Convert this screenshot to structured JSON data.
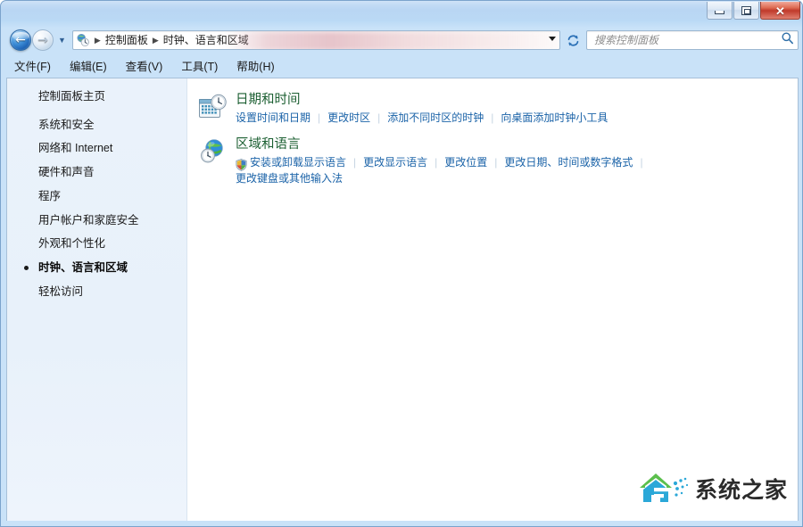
{
  "window": {
    "titlebar": {
      "minimize_label": "—",
      "maximize_label": "□",
      "close_label": "✕"
    },
    "accent_color": "#1b63a8",
    "heading_color": "#1d6033",
    "titlebar_color": "#b9d6f3"
  },
  "nav": {
    "back_arrow": "←",
    "forward_arrow": "→",
    "history_arrow": "▼",
    "breadcrumb": {
      "root_icon": "control-panel-icon",
      "separator": "▶",
      "items": [
        "控制面板",
        "时钟、语言和区域"
      ]
    },
    "refresh_icon": "refresh-icon",
    "dropdown_icon": "chevron-down-icon"
  },
  "search": {
    "placeholder": "搜索控制面板",
    "value": "",
    "icon": "search-icon"
  },
  "menubar": {
    "items": [
      {
        "label": "文件(F)"
      },
      {
        "label": "编辑(E)"
      },
      {
        "label": "查看(V)"
      },
      {
        "label": "工具(T)"
      },
      {
        "label": "帮助(H)"
      }
    ]
  },
  "sidebar": {
    "home_label": "控制面板主页",
    "items": [
      {
        "label": "系统和安全",
        "active": false
      },
      {
        "label": "网络和 Internet",
        "active": false
      },
      {
        "label": "硬件和声音",
        "active": false
      },
      {
        "label": "程序",
        "active": false
      },
      {
        "label": "用户帐户和家庭安全",
        "active": false
      },
      {
        "label": "外观和个性化",
        "active": false
      },
      {
        "label": "时钟、语言和区域",
        "active": true
      },
      {
        "label": "轻松访问",
        "active": false
      }
    ]
  },
  "content": {
    "categories": [
      {
        "icon": "calendar-clock-icon",
        "title": "日期和时间",
        "tasks": [
          {
            "label": "设置时间和日期",
            "shield": false
          },
          {
            "label": "更改时区",
            "shield": false
          },
          {
            "label": "添加不同时区的时钟",
            "shield": false
          },
          {
            "label": "向桌面添加时钟小工具",
            "shield": false
          }
        ],
        "tasks_second_line": []
      },
      {
        "icon": "globe-clock-icon",
        "title": "区域和语言",
        "tasks": [
          {
            "label": "安装或卸载显示语言",
            "shield": true
          },
          {
            "label": "更改显示语言",
            "shield": false
          },
          {
            "label": "更改位置",
            "shield": false
          },
          {
            "label": "更改日期、时间或数字格式",
            "shield": false
          }
        ],
        "tasks_second_line": [
          {
            "label": "更改键盘或其他输入法",
            "shield": false
          }
        ]
      }
    ]
  },
  "watermark": {
    "text": "系统之家",
    "logo": "house-arrow-logo"
  }
}
